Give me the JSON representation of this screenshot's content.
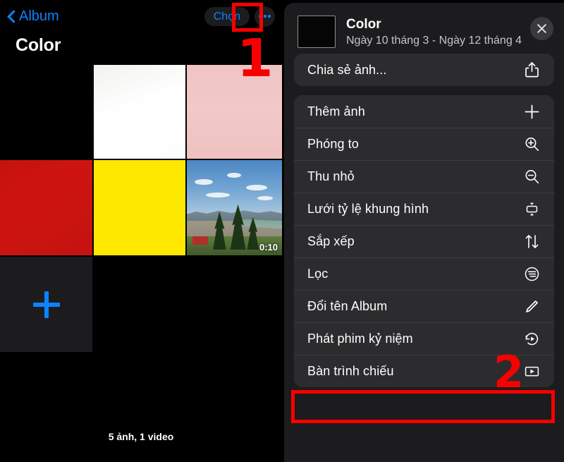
{
  "left": {
    "nav": {
      "back_label": "Album",
      "back_icon": "chevron-left-icon",
      "choose_label": "Chọn",
      "more_icon": "ellipsis-icon"
    },
    "album_title": "Color",
    "photos": [
      {
        "name": "photo-black",
        "kind": "image"
      },
      {
        "name": "photo-white",
        "kind": "image"
      },
      {
        "name": "photo-pink",
        "kind": "image"
      },
      {
        "name": "photo-red",
        "kind": "image"
      },
      {
        "name": "photo-yellow",
        "kind": "image"
      },
      {
        "name": "video-landscape",
        "kind": "video",
        "duration": "0:10"
      }
    ],
    "add_tile_icon": "plus-icon",
    "count_label": "5 ảnh, 1 video"
  },
  "sheet": {
    "title": "Color",
    "date_range": "Ngày 10 tháng 3 - Ngày 12 tháng 4",
    "close_icon": "close-icon",
    "thumbnail_name": "album-thumbnail",
    "share_group": [
      {
        "label": "Chia sẻ ảnh...",
        "icon": "share-icon"
      }
    ],
    "action_group": [
      {
        "label": "Thêm ảnh",
        "icon": "plus-icon"
      },
      {
        "label": "Phóng to",
        "icon": "zoom-in-icon"
      },
      {
        "label": "Thu nhỏ",
        "icon": "zoom-out-icon"
      },
      {
        "label": "Lưới tỷ lệ khung hình",
        "icon": "aspect-ratio-icon"
      },
      {
        "label": "Sắp xếp",
        "icon": "sort-icon"
      },
      {
        "label": "Lọc",
        "icon": "filter-icon"
      },
      {
        "label": "Đổi tên Album",
        "icon": "pencil-icon"
      },
      {
        "label": "Phát phim kỷ niệm",
        "icon": "memory-play-icon"
      },
      {
        "label": "Bàn trình chiếu",
        "icon": "slideshow-icon"
      }
    ]
  },
  "annotations": {
    "step_one": "1",
    "step_two": "2",
    "highlight_color": "#f80000"
  },
  "colors": {
    "accent_blue": "#0a84ff",
    "sheet_bg": "#1c1c1e",
    "card_bg": "#2c2c2e",
    "annotation_red": "#f80000"
  }
}
